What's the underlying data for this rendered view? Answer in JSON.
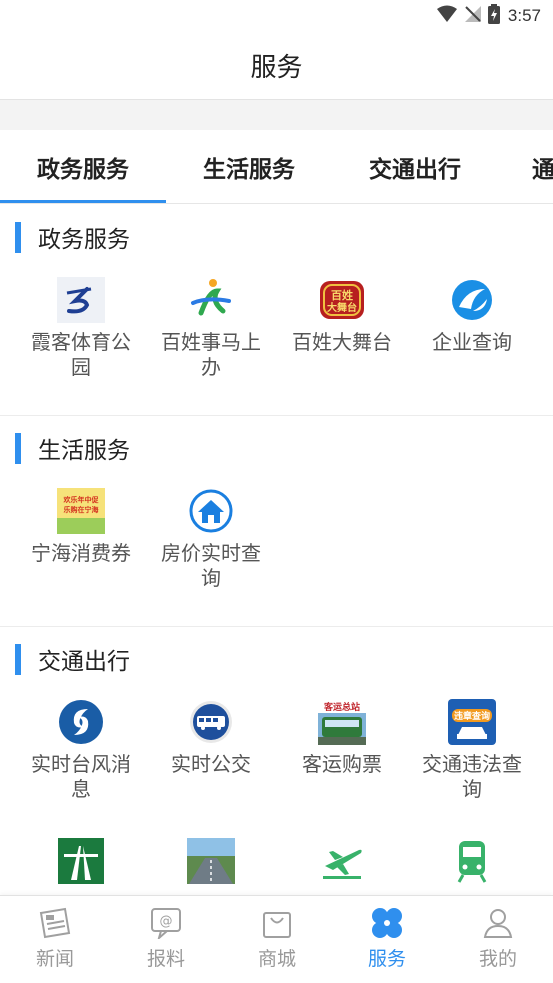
{
  "status_bar": {
    "time": "3:57"
  },
  "app_bar": {
    "title": "服务"
  },
  "tabs": [
    {
      "label": "政务服务"
    },
    {
      "label": "生活服务"
    },
    {
      "label": "交通出行"
    },
    {
      "label": "通"
    }
  ],
  "sections": [
    {
      "title": "政务服务",
      "items": [
        {
          "label": "霞客体育公园",
          "icon": "xiake-park-logo"
        },
        {
          "label": "百姓事马上办",
          "icon": "baixing-shimashangban-logo"
        },
        {
          "label": "百姓大舞台",
          "icon": "baixing-dawutai-logo",
          "icon_text": "百姓大舞台"
        },
        {
          "label": "企业查询",
          "icon": "enterprise-query-logo"
        }
      ]
    },
    {
      "title": "生活服务",
      "items": [
        {
          "label": "宁海消费券",
          "icon": "consumption-voucher-poster",
          "icon_text": "欢乐年中促 乐购在宁海"
        },
        {
          "label": "房价实时查询",
          "icon": "house-icon"
        }
      ]
    },
    {
      "title": "交通出行",
      "items": [
        {
          "label": "实时台风消息",
          "icon": "typhoon-icon"
        },
        {
          "label": "实时公交",
          "icon": "bus-icon"
        },
        {
          "label": "客运购票",
          "icon": "coach-ticket-photo",
          "icon_text": "客运总站"
        },
        {
          "label": "交通违法查询",
          "icon": "traffic-violation-icon",
          "icon_text": "违章查询"
        },
        {
          "label": "",
          "icon": "highway-icon"
        },
        {
          "label": "",
          "icon": "road-photo"
        },
        {
          "label": "",
          "icon": "airplane-icon"
        },
        {
          "label": "",
          "icon": "train-icon"
        }
      ]
    }
  ],
  "bottom_nav": [
    {
      "label": "新闻",
      "icon": "newspaper-icon",
      "active": false
    },
    {
      "label": "报料",
      "icon": "at-message-icon",
      "active": false
    },
    {
      "label": "商城",
      "icon": "shopping-bag-icon",
      "active": false
    },
    {
      "label": "服务",
      "icon": "services-grid-icon",
      "active": true
    },
    {
      "label": "我的",
      "icon": "user-icon",
      "active": false
    }
  ],
  "colors": {
    "accent": "#2f8fee",
    "muted": "#999999"
  }
}
